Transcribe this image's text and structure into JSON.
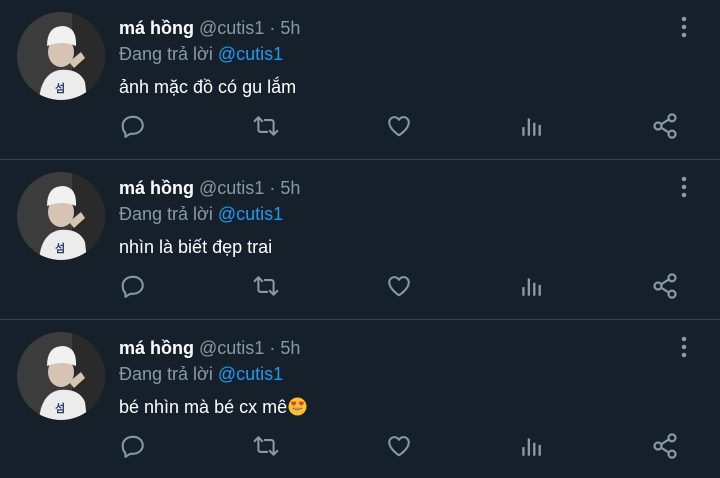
{
  "colors": {
    "background": "#15202b",
    "divider": "#38444d",
    "text": "#ffffff",
    "muted": "#8899a6",
    "accent": "#1d9bf0"
  },
  "tweets": [
    {
      "name": "má hồng",
      "handle": "@cutis1",
      "dot": "·",
      "time": "5h",
      "replying_prefix": "Đang trả lời",
      "replying_to": "@cutis1",
      "text": "ảnh mặc đồ có gu lắm",
      "emoji": ""
    },
    {
      "name": "má hồng",
      "handle": "@cutis1",
      "dot": "·",
      "time": "5h",
      "replying_prefix": "Đang trả lời",
      "replying_to": "@cutis1",
      "text": "nhìn là biết đẹp trai",
      "emoji": ""
    },
    {
      "name": "má hồng",
      "handle": "@cutis1",
      "dot": "·",
      "time": "5h",
      "replying_prefix": "Đang trả lời",
      "replying_to": "@cutis1",
      "text": "bé nhìn mà bé cx mê",
      "emoji": "heart-eyes-emoji"
    }
  ],
  "icons": {
    "reply": "reply-icon",
    "retweet": "retweet-icon",
    "like": "heart-icon",
    "stats": "analytics-icon",
    "share": "share-icon",
    "more": "more-options-icon"
  }
}
